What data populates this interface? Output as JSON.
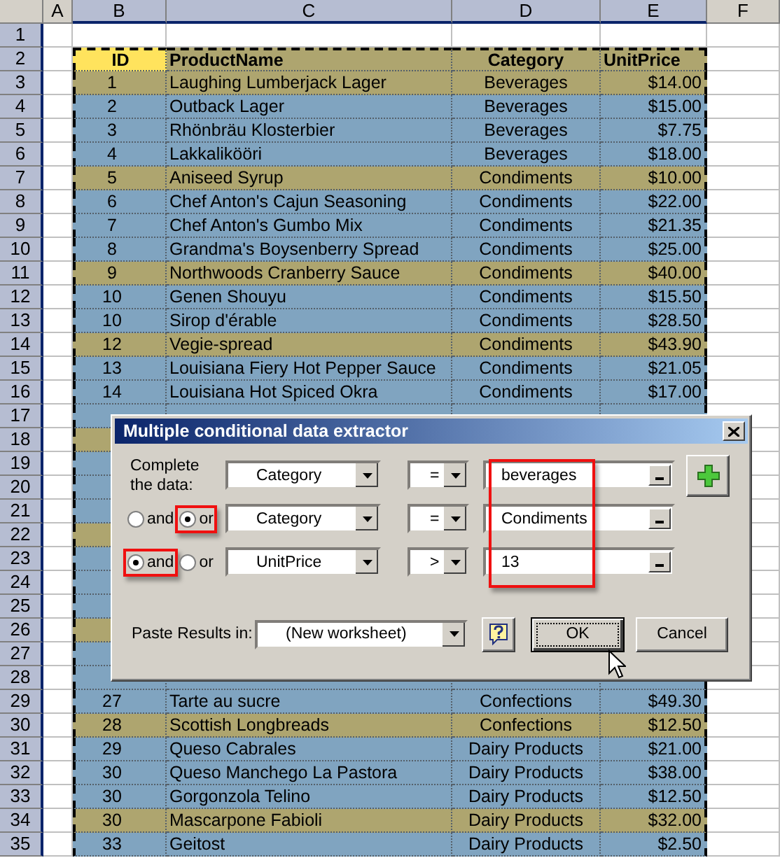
{
  "columns": [
    {
      "label": "A",
      "selected": false
    },
    {
      "label": "B",
      "selected": true
    },
    {
      "label": "C",
      "selected": true
    },
    {
      "label": "D",
      "selected": true
    },
    {
      "label": "E",
      "selected": true
    },
    {
      "label": "F",
      "selected": false
    }
  ],
  "rows": [
    {
      "number": "1",
      "kind": "blank"
    },
    {
      "number": "2",
      "kind": "header",
      "cells": [
        {
          "text": "ID",
          "selected": true
        },
        {
          "text": "ProductName",
          "selected": false
        },
        {
          "text": "Category",
          "selected": false
        },
        {
          "text": "UnitPrice",
          "selected": false
        }
      ]
    },
    {
      "number": "3",
      "kind": "record",
      "highlighted": true,
      "cells": [
        "1",
        "Laughing Lumberjack Lager",
        "Beverages",
        "$14.00"
      ]
    },
    {
      "number": "4",
      "kind": "record",
      "highlighted": false,
      "cells": [
        "2",
        "Outback Lager",
        "Beverages",
        "$15.00"
      ]
    },
    {
      "number": "5",
      "kind": "record",
      "highlighted": false,
      "cells": [
        "3",
        "Rhönbräu Klosterbier",
        "Beverages",
        "$7.75"
      ]
    },
    {
      "number": "6",
      "kind": "record",
      "highlighted": false,
      "cells": [
        "4",
        "Lakkalikööri",
        "Beverages",
        "$18.00"
      ]
    },
    {
      "number": "7",
      "kind": "record",
      "highlighted": true,
      "cells": [
        "5",
        "Aniseed Syrup",
        "Condiments",
        "$10.00"
      ]
    },
    {
      "number": "8",
      "kind": "record",
      "highlighted": false,
      "cells": [
        "6",
        "Chef Anton's Cajun Seasoning",
        "Condiments",
        "$22.00"
      ]
    },
    {
      "number": "9",
      "kind": "record",
      "highlighted": false,
      "cells": [
        "7",
        "Chef Anton's Gumbo Mix",
        "Condiments",
        "$21.35"
      ]
    },
    {
      "number": "10",
      "kind": "record",
      "highlighted": false,
      "cells": [
        "8",
        "Grandma's Boysenberry Spread",
        "Condiments",
        "$25.00"
      ]
    },
    {
      "number": "11",
      "kind": "record",
      "highlighted": true,
      "cells": [
        "9",
        "Northwoods Cranberry Sauce",
        "Condiments",
        "$40.00"
      ]
    },
    {
      "number": "12",
      "kind": "record",
      "highlighted": false,
      "cells": [
        "10",
        "Genen Shouyu",
        "Condiments",
        "$15.50"
      ]
    },
    {
      "number": "13",
      "kind": "record",
      "highlighted": false,
      "cells": [
        "10",
        "Sirop d'érable",
        "Condiments",
        "$28.50"
      ]
    },
    {
      "number": "14",
      "kind": "record",
      "highlighted": true,
      "cells": [
        "12",
        "Vegie-spread",
        "Condiments",
        "$43.90"
      ]
    },
    {
      "number": "15",
      "kind": "record",
      "highlighted": false,
      "cells": [
        "13",
        "Louisiana Fiery Hot Pepper Sauce",
        "Condiments",
        "$21.05"
      ]
    },
    {
      "number": "16",
      "kind": "record",
      "highlighted": false,
      "cells": [
        "14",
        "Louisiana Hot Spiced Okra",
        "Condiments",
        "$17.00"
      ]
    },
    {
      "number": "17",
      "kind": "record",
      "highlighted": false
    },
    {
      "number": "18",
      "kind": "record",
      "highlighted": true
    },
    {
      "number": "19",
      "kind": "record",
      "highlighted": false
    },
    {
      "number": "20",
      "kind": "record",
      "highlighted": false
    },
    {
      "number": "21",
      "kind": "record",
      "highlighted": false
    },
    {
      "number": "22",
      "kind": "record",
      "highlighted": true
    },
    {
      "number": "23",
      "kind": "record",
      "highlighted": false
    },
    {
      "number": "24",
      "kind": "record",
      "highlighted": false
    },
    {
      "number": "25",
      "kind": "record",
      "highlighted": false
    },
    {
      "number": "26",
      "kind": "record",
      "highlighted": true
    },
    {
      "number": "27",
      "kind": "record",
      "highlighted": false
    },
    {
      "number": "28",
      "kind": "record",
      "highlighted": false
    },
    {
      "number": "29",
      "kind": "record",
      "highlighted": false,
      "cells": [
        "27",
        "Tarte au sucre",
        "Confections",
        "$49.30"
      ]
    },
    {
      "number": "30",
      "kind": "record",
      "highlighted": true,
      "cells": [
        "28",
        "Scottish Longbreads",
        "Confections",
        "$12.50"
      ]
    },
    {
      "number": "31",
      "kind": "record",
      "highlighted": false,
      "cells": [
        "29",
        "Queso Cabrales",
        "Dairy Products",
        "$21.00"
      ]
    },
    {
      "number": "32",
      "kind": "record",
      "highlighted": false,
      "cells": [
        "30",
        "Queso Manchego La Pastora",
        "Dairy Products",
        "$38.00"
      ]
    },
    {
      "number": "33",
      "kind": "record",
      "highlighted": false,
      "cells": [
        "30",
        "Gorgonzola Telino",
        "Dairy Products",
        "$12.50"
      ]
    },
    {
      "number": "34",
      "kind": "record",
      "highlighted": true,
      "cells": [
        "30",
        "Mascarpone Fabioli",
        "Dairy Products",
        "$32.00"
      ]
    },
    {
      "number": "35",
      "kind": "record",
      "highlighted": false,
      "cells": [
        "33",
        "Geitost",
        "Dairy Products",
        "$2.50"
      ]
    }
  ],
  "dialog": {
    "title": "Multiple conditional data extractor",
    "intro": "Complete the data:",
    "values_highlighted": true,
    "conditions": [
      {
        "field": "Category",
        "operator": "=",
        "value": "beverages"
      },
      {
        "connectors": [
          {
            "label": "and",
            "selected": false,
            "highlighted": false
          },
          {
            "label": "or",
            "selected": true,
            "highlighted": true
          }
        ],
        "field": "Category",
        "operator": "=",
        "value": "Condiments"
      },
      {
        "connectors": [
          {
            "label": "and",
            "selected": true,
            "highlighted": true
          },
          {
            "label": "or",
            "selected": false,
            "highlighted": false
          }
        ],
        "field": "UnitPrice",
        "operator": ">",
        "value": "13"
      }
    ],
    "paste_label": "Paste Results in:",
    "paste_target": "(New worksheet)",
    "buttons": [
      {
        "label": "OK",
        "default": true
      },
      {
        "label": "Cancel",
        "default": false
      }
    ]
  }
}
